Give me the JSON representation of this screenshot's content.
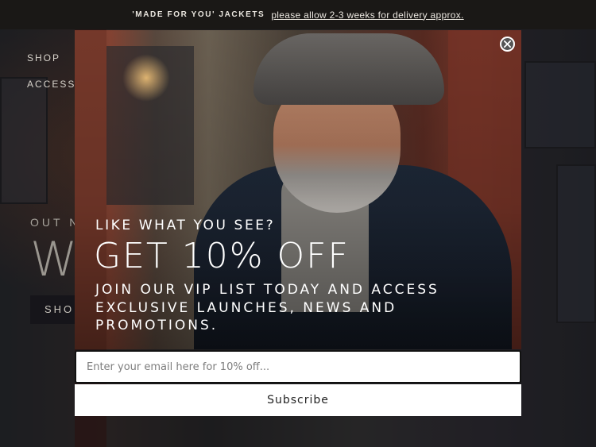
{
  "announcement": {
    "label": "'MADE FOR YOU' JACKETS",
    "link_text": "please allow 2-3 weeks for delivery approx."
  },
  "background_page": {
    "nav": [
      "SHOP",
      "ACCESS"
    ],
    "eyebrow": "OUT N",
    "headline_fragment": "W",
    "button_fragment": "SHO"
  },
  "modal": {
    "eyebrow": "LIKE WHAT YOU SEE?",
    "headline": "GET 10% OFF",
    "subtext": "JOIN OUR VIP LIST TODAY AND ACCESS EXCLUSIVE LAUNCHES, NEWS AND PROMOTIONS.",
    "email_placeholder": "Enter your email here for 10% off...",
    "subscribe_label": "Subscribe",
    "close_icon": "close-icon"
  },
  "colors": {
    "announcement_bg": "#1a1816",
    "modal_text": "#ffffff",
    "input_border": "#111111"
  }
}
